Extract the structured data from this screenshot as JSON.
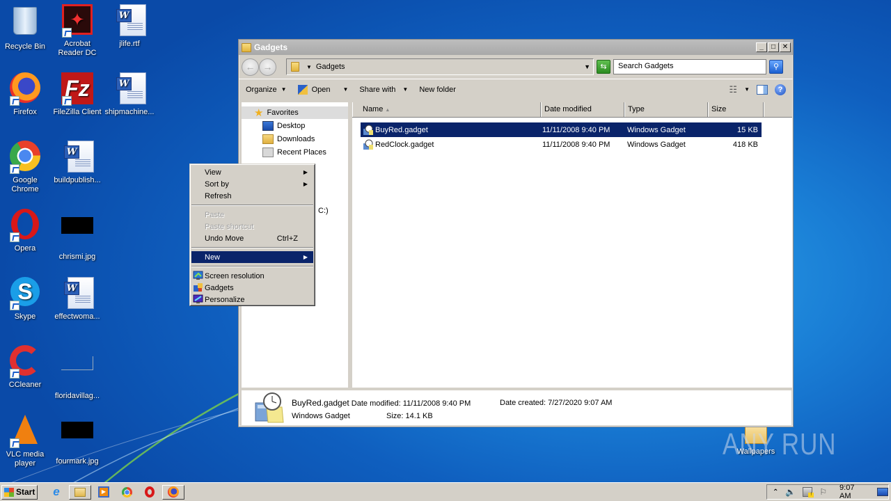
{
  "desktop": {
    "icons": [
      {
        "label": "Recycle Bin",
        "icon": "recycle-bin-icon"
      },
      {
        "label": "Acrobat Reader DC",
        "icon": "acrobat-icon"
      },
      {
        "label": "jlife.rtf",
        "icon": "word-document-icon"
      },
      {
        "label": "Firefox",
        "icon": "firefox-icon"
      },
      {
        "label": "FileZilla Client",
        "icon": "filezilla-icon"
      },
      {
        "label": "shipmachine...",
        "icon": "word-document-icon"
      },
      {
        "label": "Google Chrome",
        "icon": "chrome-icon"
      },
      {
        "label": "buildpublish...",
        "icon": "word-document-icon"
      },
      {
        "label": "Opera",
        "icon": "opera-icon"
      },
      {
        "label": "chrismi.jpg",
        "icon": "image-file-icon"
      },
      {
        "label": "Skype",
        "icon": "skype-icon"
      },
      {
        "label": "effectwoma...",
        "icon": "word-document-icon"
      },
      {
        "label": "CCleaner",
        "icon": "ccleaner-icon"
      },
      {
        "label": "floridavillag...",
        "icon": "image-file-icon"
      },
      {
        "label": "VLC media player",
        "icon": "vlc-icon"
      },
      {
        "label": "fourmark.jpg",
        "icon": "image-file-icon"
      },
      {
        "label": "Wallpapers",
        "icon": "folder-icon"
      }
    ],
    "watermark": "ANY RUN"
  },
  "window": {
    "title": "Gadgets",
    "address": "Gadgets",
    "search_placeholder": "Search Gadgets",
    "toolbar": {
      "organize": "Organize",
      "open": "Open",
      "share_with": "Share with",
      "new_folder": "New folder"
    },
    "nav": {
      "favorites": "Favorites",
      "items": [
        "Desktop",
        "Downloads",
        "Recent Places"
      ],
      "partial_drive": "C:)"
    },
    "columns": [
      "Name",
      "Date modified",
      "Type",
      "Size"
    ],
    "files": [
      {
        "name": "BuyRed.gadget",
        "date": "11/11/2008 9:40 PM",
        "type": "Windows Gadget",
        "size": "15 KB",
        "selected": true
      },
      {
        "name": "RedClock.gadget",
        "date": "11/11/2008 9:40 PM",
        "type": "Windows Gadget",
        "size": "418 KB",
        "selected": false
      }
    ],
    "details": {
      "name": "BuyRed.gadget",
      "type": "Windows Gadget",
      "date_modified_label": "Date modified:",
      "date_modified": "11/11/2008 9:40 PM",
      "date_created_label": "Date created:",
      "date_created": "7/27/2020 9:07 AM",
      "size_label": "Size:",
      "size": "14.1 KB"
    }
  },
  "context_menu": {
    "items": [
      {
        "label": "View",
        "submenu": true
      },
      {
        "label": "Sort by",
        "submenu": true
      },
      {
        "label": "Refresh"
      },
      {
        "label": "Paste",
        "disabled": true
      },
      {
        "label": "Paste shortcut",
        "disabled": true
      },
      {
        "label": "Undo Move",
        "shortcut": "Ctrl+Z"
      },
      {
        "label": "New",
        "submenu": true,
        "highlighted": true
      },
      {
        "label": "Screen resolution",
        "icon": "screen-resolution-icon"
      },
      {
        "label": "Gadgets",
        "icon": "gadgets-icon"
      },
      {
        "label": "Personalize",
        "icon": "personalize-icon"
      }
    ]
  },
  "taskbar": {
    "start_label": "Start",
    "pinned": [
      "Internet Explorer",
      "Windows Explorer",
      "Windows Media Player",
      "Google Chrome",
      "Opera",
      "Firefox"
    ],
    "clock": "9:07 AM"
  },
  "colors": {
    "selection": "#0a246a",
    "chrome_gray": "#d4d0c8",
    "desktop_blue": "#1a7fd6"
  }
}
